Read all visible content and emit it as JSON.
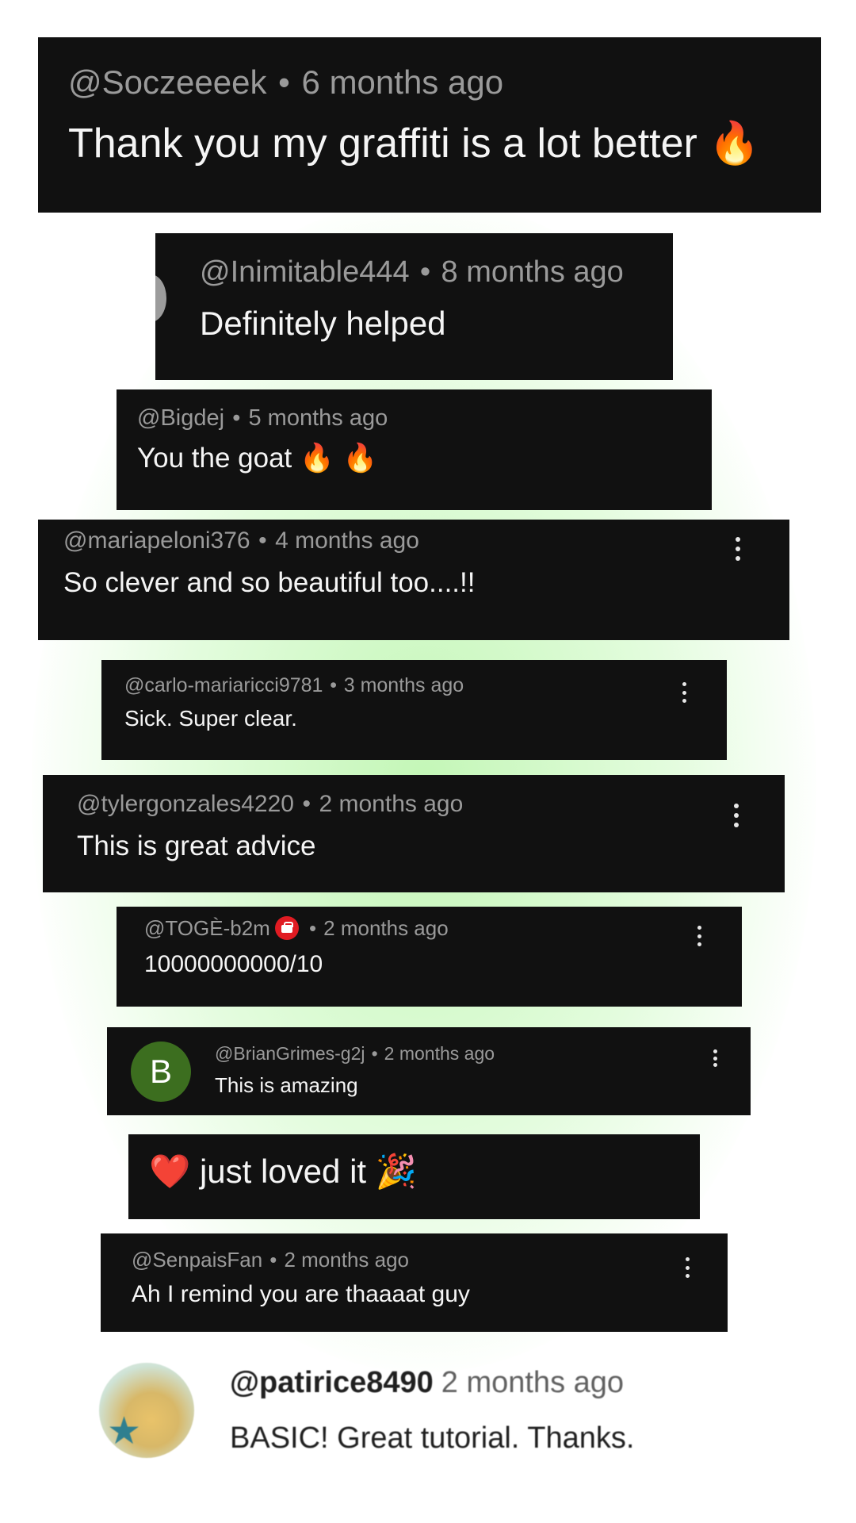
{
  "separator": "•",
  "comments": [
    {
      "user": "@Soczeeeek",
      "time": "6 months ago",
      "text": "Thank you my graffiti is a lot better",
      "emoji": "🔥"
    },
    {
      "user": "@Inimitable444",
      "time": "8 months ago",
      "text": "Definitely helped"
    },
    {
      "user": "@Bigdej",
      "time": "5 months ago",
      "text": "You the goat",
      "emoji": "🔥 🔥"
    },
    {
      "user": "@mariapeloni376",
      "time": "4 months ago",
      "text": "So clever and so beautiful too....!!"
    },
    {
      "user": "@carlo-mariaricci9781",
      "time": "3 months ago",
      "text": "Sick. Super clear."
    },
    {
      "user": "@tylergonzales4220",
      "time": "2 months ago",
      "text": "This is great advice"
    },
    {
      "user": "@TOGÈ-b2m",
      "time": "2 months ago",
      "text": "10000000000/10",
      "badge_icon": "gift-icon"
    },
    {
      "user": "@BrianGrimes-g2j",
      "time": "2 months ago",
      "text": "This is amazing",
      "avatar_letter": "B",
      "avatar_color": "#3c6e1f"
    },
    {
      "text": "just loved  it",
      "emoji_before": "❤️",
      "emoji_after": "🎉"
    },
    {
      "user": "@SenpaisFan",
      "time": "2 months ago",
      "text": "Ah I remind you are thaaaat guy"
    },
    {
      "user": "@patirice8490",
      "time": "2 months ago",
      "text": "BASIC! Great tutorial. Thanks."
    }
  ],
  "colors": {
    "card": "#111111",
    "glow": "#b9f5aa",
    "badge": "#e01b22"
  }
}
